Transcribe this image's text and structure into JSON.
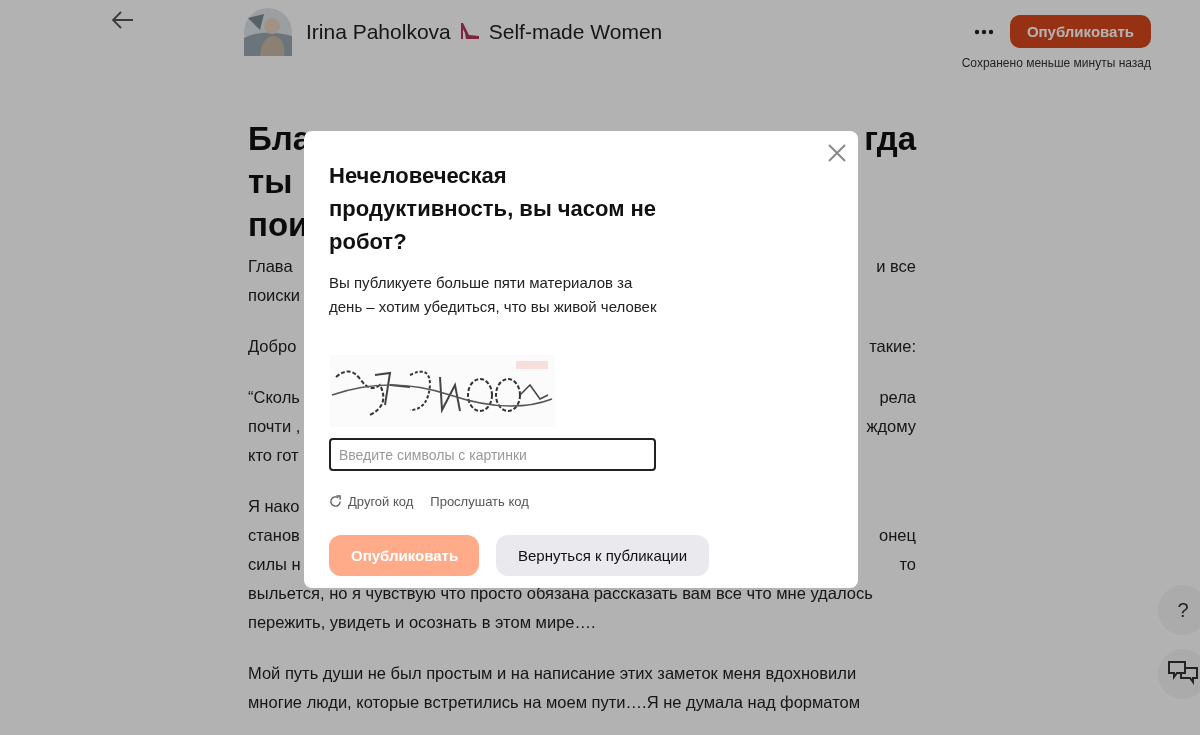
{
  "header": {
    "author": "Irina Paholkova",
    "channel": "Self-made Women",
    "publish_button": "Опубликовать",
    "saved_status": "Сохранено меньше минуты назад"
  },
  "article": {
    "title_lines": [
      {
        "left": "Бла",
        "right": "гда"
      },
      {
        "left": "ты"
      },
      {
        "left": "пои"
      }
    ],
    "paragraphs": [
      {
        "lines": [
          {
            "left": "Глава",
            "right": "и все"
          },
          {
            "left": "поиски"
          }
        ]
      },
      {
        "lines": [
          {
            "left": "Добро",
            "right": "такие:"
          }
        ]
      },
      {
        "lines": [
          {
            "left": "“Сколь",
            "right": "рела"
          },
          {
            "left": "почти ,",
            "right": "ждому"
          },
          {
            "left": "кто гот"
          }
        ]
      },
      {
        "lines": [
          {
            "left": "Я нако"
          },
          {
            "left": "станов",
            "right": "онец"
          },
          {
            "left": "силы н",
            "right": "то"
          },
          {
            "left": "выльется, но я чувствую что просто обязана рассказать вам все что мне удалось"
          },
          {
            "left": "пережить, увидеть и осознать в этом мире…."
          }
        ]
      },
      {
        "lines": [
          {
            "left": "Мой путь души не был простым и на написание этих заметок меня вдохновили"
          },
          {
            "left": "многие люди, которые встретились на моем пути….Я не думала над форматом"
          }
        ]
      }
    ]
  },
  "dialog": {
    "title": "Нечеловеческая продуктивность, вы часом не робот?",
    "description": "Вы публикуете больше пяти материалов за день – хотим убедиться, что вы живой человек",
    "captcha": {
      "kind": "picture"
    },
    "input": {
      "placeholder": "Введите символы с картинки"
    },
    "links": [
      "Другой код",
      "Прослушать код"
    ],
    "buttons": [
      {
        "label": "Опубликовать",
        "kind": "primary",
        "disabled": true
      },
      {
        "label": "Вернуться к публикации",
        "kind": "secondary",
        "disabled": false
      }
    ]
  },
  "help_button": "?"
}
